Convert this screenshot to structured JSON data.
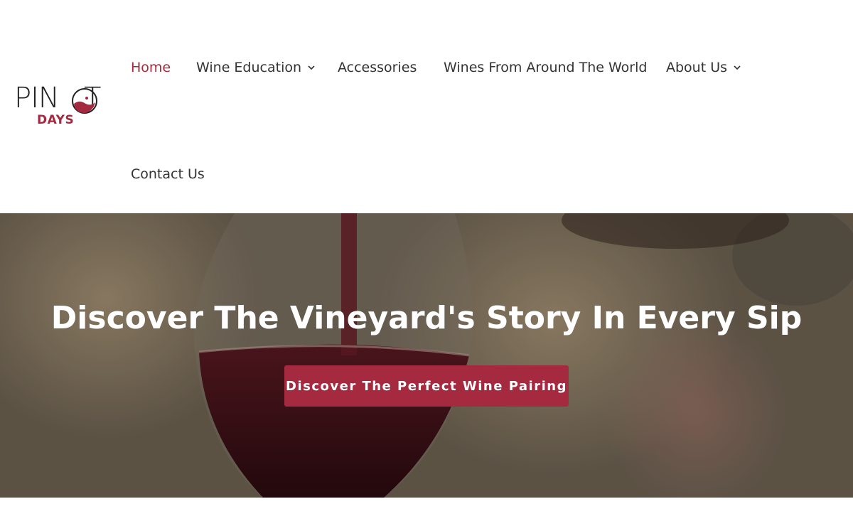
{
  "logo": {
    "main_text": "PIN T",
    "sub_text": "DAYS"
  },
  "nav": {
    "items": [
      {
        "label": "Home",
        "active": true
      },
      {
        "label": "Wine Education",
        "has_dropdown": true
      },
      {
        "label": "Accessories"
      },
      {
        "label": "Wines From Around The World"
      },
      {
        "label": "About Us",
        "has_dropdown": true
      },
      {
        "label": "Contact Us"
      }
    ]
  },
  "hero": {
    "title": "Discover The Vineyard's Story In Every Sip",
    "cta_label": "Discover The Perfect Wine Pairing"
  },
  "colors": {
    "accent": "#a52a3f",
    "nav_text": "#333333",
    "hero_text": "#ffffff"
  }
}
